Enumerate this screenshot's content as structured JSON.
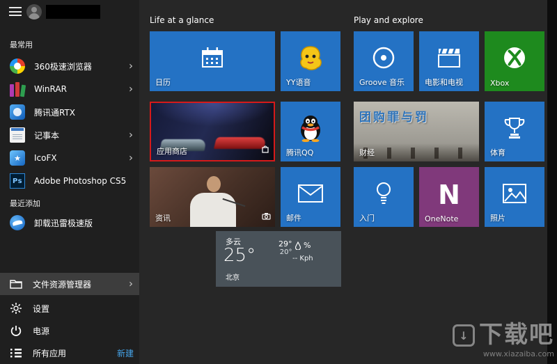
{
  "colors": {
    "tile_blue": "#2472c4",
    "tile_green": "#1e8a1e",
    "tile_purple": "#80397b",
    "selection_red": "#d61a1a",
    "accent_link": "#45a3e8",
    "sidebar_bg": "#1f1f1f",
    "menu_bg": "#272727"
  },
  "sidebar": {
    "most_used_label": "最常用",
    "recent_label": "最近添加",
    "arrow": "›",
    "most_used": [
      {
        "label": "360极速浏览器"
      },
      {
        "label": "WinRAR"
      },
      {
        "label": "腾讯通RTX"
      },
      {
        "label": "记事本"
      },
      {
        "label": "IcoFX"
      },
      {
        "label": "Adobe Photoshop CS5"
      }
    ],
    "recent": [
      {
        "label": "卸载迅雷极速版"
      }
    ],
    "ps_badge": "Ps",
    "file_explorer": "文件资源管理器",
    "settings": "设置",
    "power": "电源",
    "all_apps": "所有应用",
    "new_label": "新建"
  },
  "groups": {
    "left_title": "Life at a glance",
    "right_title": "Play and explore"
  },
  "tiles": {
    "calendar": "日历",
    "yy": "YY语音",
    "store": "应用商店",
    "qq": "腾讯QQ",
    "news": "资讯",
    "mail": "邮件",
    "groove": "Groove 音乐",
    "movies": "电影和电视",
    "xbox": "Xbox",
    "finance": "财经",
    "finance_overlay": "团购罪与罚",
    "sports": "体育",
    "getstarted": "入门",
    "onenote": "OneNote",
    "onenote_letter": "N",
    "photos": "照片"
  },
  "weather": {
    "condition": "多云",
    "temp": "25°",
    "high": "29°",
    "low": "20°",
    "humidity": "%",
    "wind": "-- Kph",
    "city": "北京"
  },
  "watermark": {
    "title": "下载吧",
    "url": "www.xiazaiba.com"
  }
}
